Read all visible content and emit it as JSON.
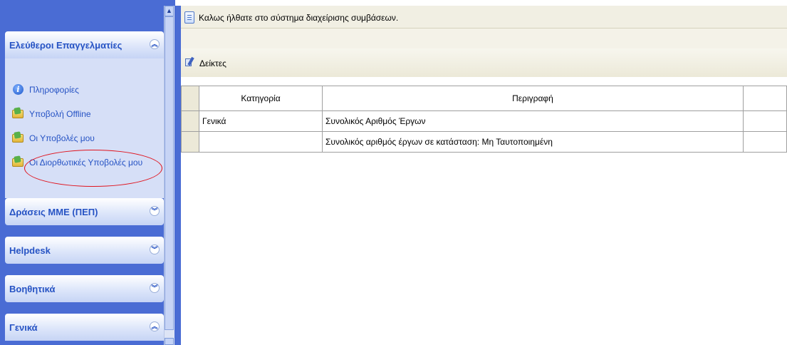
{
  "sidebar": {
    "panels": [
      {
        "title": "Ελεύθεροι Επαγγελματίες",
        "chevron": "collapse",
        "items": [
          {
            "icon": "info-icon",
            "label": "Πληροφορίες"
          },
          {
            "icon": "folder-icon",
            "label": "Υποβολή Offline"
          },
          {
            "icon": "folder-icon",
            "label": "Οι Υποβολές μου"
          },
          {
            "icon": "folder-icon",
            "label": "Οι Διορθωτικές Υποβολές μου",
            "highlighted": true
          }
        ]
      },
      {
        "title": "Δράσεις ΜΜΕ (ΠΕΠ)",
        "chevron": "expand"
      },
      {
        "title": "Helpdesk",
        "chevron": "expand"
      },
      {
        "title": "Βοηθητικά",
        "chevron": "expand"
      },
      {
        "title": "Γενικά",
        "chevron": "collapse"
      }
    ]
  },
  "main": {
    "welcome_text": "Καλως ήλθατε στο σύστημα διαχείρισης συμβάσεων.",
    "section_title": "Δείκτες",
    "table": {
      "columns": [
        "Κατηγορία",
        "Περιγραφή"
      ],
      "rows": [
        {
          "category": "Γενικά",
          "description": "Συνολικός Αριθμός Έργων"
        },
        {
          "category": "",
          "description": "Συνολικός αριθμός έργων σε κατάσταση: Μη Ταυτοποιημένη"
        }
      ]
    }
  },
  "colors": {
    "nav_background": "#4a6cd4",
    "nav_text": "#2653c4",
    "highlight_oval": "#e0141e"
  }
}
